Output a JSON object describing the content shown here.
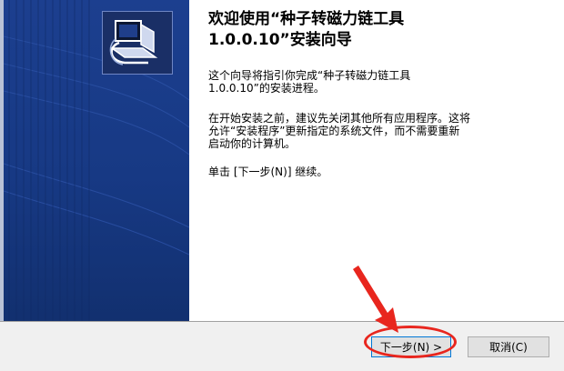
{
  "wizard": {
    "title": "欢迎使用“种子转磁力链工具\n1.0.0.10”安装向导",
    "paragraph1": "这个向导将指引你完成“种子转磁力链工具\n1.0.0.10”的安装进程。",
    "paragraph2": "在开始安装之前，建议先关闭其他所有应用程序。这将\n允许“安装程序”更新指定的系统文件，而不需要重新\n启动你的计算机。",
    "paragraph3": "单击 [下一步(N)] 继续。"
  },
  "footer": {
    "next_label": "下一步(N) >",
    "cancel_label": "取消(C)"
  },
  "icons": {
    "logo": "installer-computer-icon"
  },
  "colors": {
    "panel_blue": "#1a3b86",
    "annotation_red": "#e8261e"
  }
}
